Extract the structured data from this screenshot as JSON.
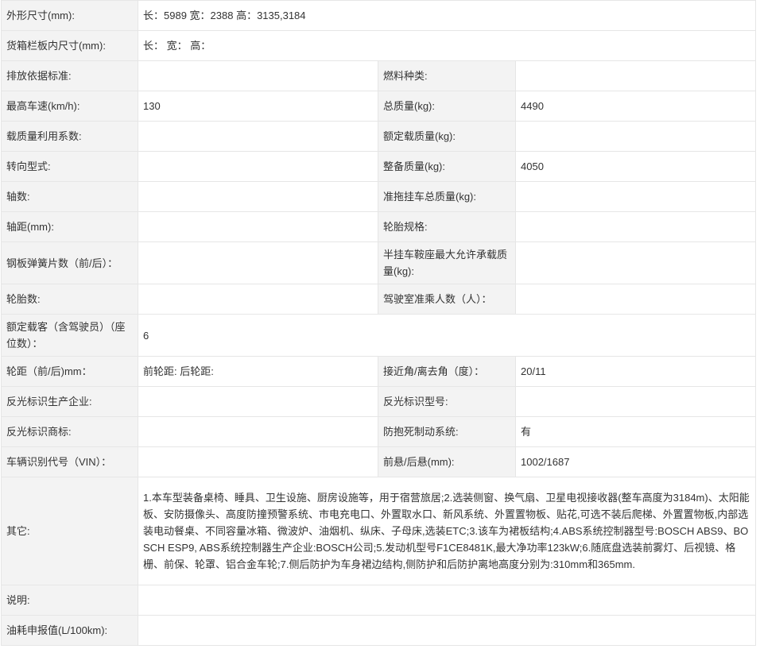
{
  "rows": [
    {
      "label": "外形尺寸(mm):",
      "value": "长：5989 宽：2388 高：3135,3184"
    },
    {
      "label": "货箱栏板内尺寸(mm):",
      "value": "长： 宽： 高："
    },
    {
      "label": "排放依据标准:",
      "value": "",
      "label2": "燃料种类:",
      "value2": ""
    },
    {
      "label": "最高车速(km/h):",
      "value": "130",
      "label2": "总质量(kg):",
      "value2": "4490"
    },
    {
      "label": "载质量利用系数:",
      "value": "",
      "label2": "额定载质量(kg):",
      "value2": ""
    },
    {
      "label": "转向型式:",
      "value": "",
      "label2": "整备质量(kg):",
      "value2": "4050"
    },
    {
      "label": "轴数:",
      "value": "",
      "label2": "准拖挂车总质量(kg):",
      "value2": ""
    },
    {
      "label": "轴距(mm):",
      "value": "",
      "label2": "轮胎规格:",
      "value2": ""
    },
    {
      "label": "钢板弹簧片数（前/后）：",
      "value": "",
      "label2": "半挂车鞍座最大允许承载质量(kg):",
      "value2": ""
    },
    {
      "label": "轮胎数:",
      "value": "",
      "label2": "驾驶室准乘人数（人）：",
      "value2": ""
    },
    {
      "label": "额定载客（含驾驶员）（座位数）：",
      "value": "6"
    },
    {
      "label": "轮距（前/后)mm：",
      "value": "前轮距: 后轮距:",
      "label2": "接近角/离去角（度）：",
      "value2": "20/11"
    },
    {
      "label": "反光标识生产企业:",
      "value": "",
      "label2": "反光标识型号:",
      "value2": ""
    },
    {
      "label": "反光标识商标:",
      "value": "",
      "label2": "防抱死制动系统:",
      "value2": "有"
    },
    {
      "label": "车辆识别代号（VIN）：",
      "value": "",
      "label2": "前悬/后悬(mm):",
      "value2": "1002/1687"
    },
    {
      "label": "其它:",
      "value": "1.本车型装备桌椅、睡具、卫生设施、厨房设施等，用于宿营旅居;2.选装侧窗、换气扇、卫星电视接收器(整车高度为3184m)、太阳能板、安防摄像头、高度防撞预警系统、市电充电口、外置取水口、新风系统、外置置物板、贴花,可选不装后爬梯、外置置物板,内部选装电动餐桌、不同容量冰箱、微波炉、油烟机、纵床、子母床,选装ETC;3.该车为裙板结构;4.ABS系统控制器型号:BOSCH ABS9、BOSCH ESP9, ABS系统控制器生产企业:BOSCH公司;5.发动机型号F1CE8481K,最大净功率123kW;6.随底盘选装前雾灯、后视镜、格栅、前保、轮罩、铝合金车轮;7.侧后防护为车身裙边结构,侧防护和后防护离地高度分别为:310mm和365mm."
    },
    {
      "label": "说明:",
      "value": ""
    },
    {
      "label": "油耗申报值(L/100km):",
      "value": ""
    }
  ]
}
